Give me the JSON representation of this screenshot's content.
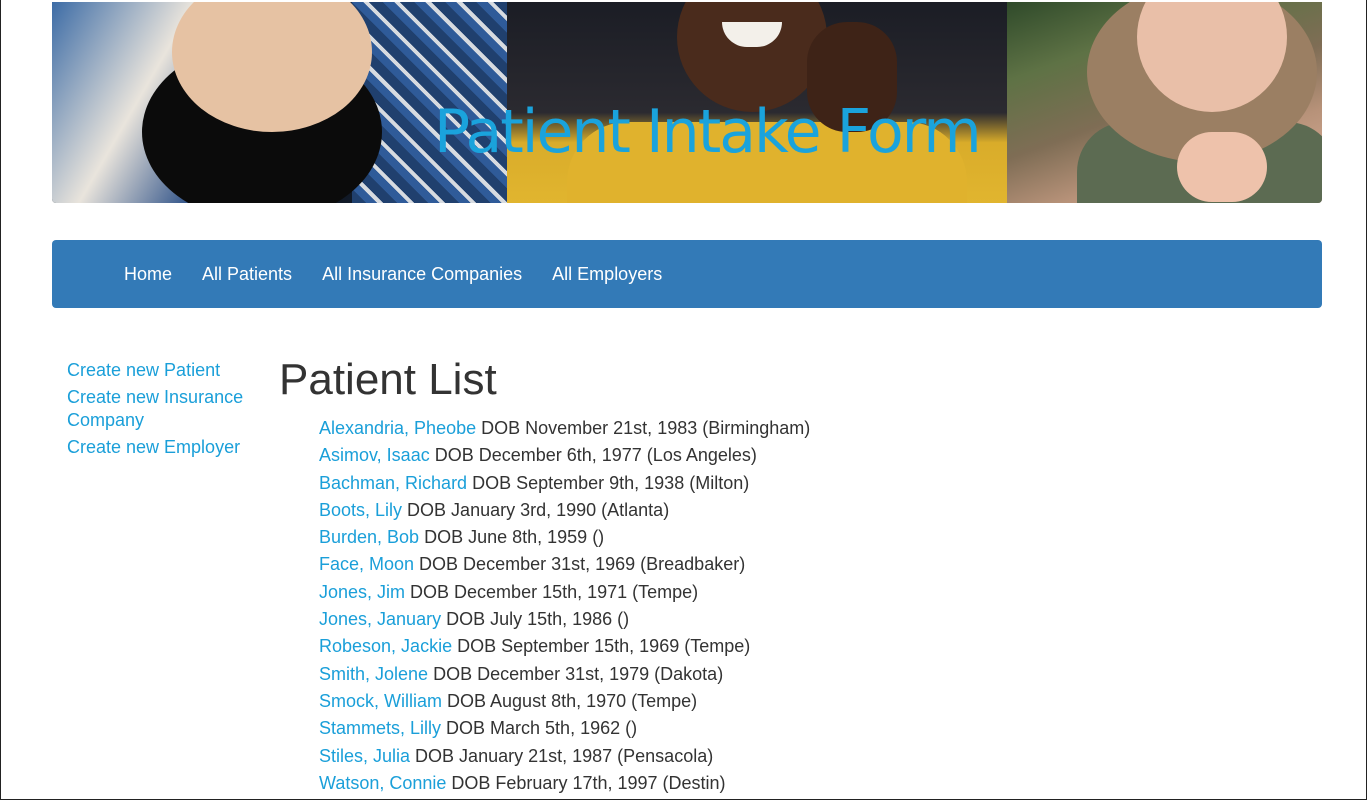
{
  "banner": {
    "title": "Patient Intake Form"
  },
  "nav": {
    "items": [
      {
        "label": "Home"
      },
      {
        "label": "All Patients"
      },
      {
        "label": "All Insurance Companies"
      },
      {
        "label": "All Employers"
      }
    ]
  },
  "sidebar": {
    "links": [
      {
        "label": "Create new Patient"
      },
      {
        "label": "Create new Insurance Company"
      },
      {
        "label": "Create new Employer"
      }
    ]
  },
  "main": {
    "title": "Patient List",
    "patients": [
      {
        "name": "Alexandria, Pheobe",
        "info": " DOB November 21st, 1983 (Birmingham)"
      },
      {
        "name": "Asimov, Isaac",
        "info": " DOB December 6th, 1977 (Los Angeles)"
      },
      {
        "name": "Bachman, Richard",
        "info": " DOB September 9th, 1938 (Milton)"
      },
      {
        "name": "Boots, Lily",
        "info": " DOB January 3rd, 1990 (Atlanta)"
      },
      {
        "name": "Burden, Bob",
        "info": " DOB June 8th, 1959 ()"
      },
      {
        "name": "Face, Moon",
        "info": " DOB December 31st, 1969 (Breadbaker)"
      },
      {
        "name": "Jones, Jim",
        "info": " DOB December 15th, 1971 (Tempe)"
      },
      {
        "name": "Jones, January",
        "info": " DOB July 15th, 1986 ()"
      },
      {
        "name": "Robeson, Jackie",
        "info": " DOB September 15th, 1969 (Tempe)"
      },
      {
        "name": "Smith, Jolene",
        "info": " DOB December 31st, 1979 (Dakota)"
      },
      {
        "name": "Smock, William",
        "info": " DOB August 8th, 1970 (Tempe)"
      },
      {
        "name": "Stammets, Lilly",
        "info": " DOB March 5th, 1962 ()"
      },
      {
        "name": "Stiles, Julia",
        "info": " DOB January 21st, 1987 (Pensacola)"
      },
      {
        "name": "Watson, Connie",
        "info": " DOB February 17th, 1997 (Destin)"
      }
    ]
  },
  "colors": {
    "navbar": "#337ab7",
    "link": "#1a9fd9",
    "banner_title": "#1aa3dc",
    "text": "#333333"
  }
}
